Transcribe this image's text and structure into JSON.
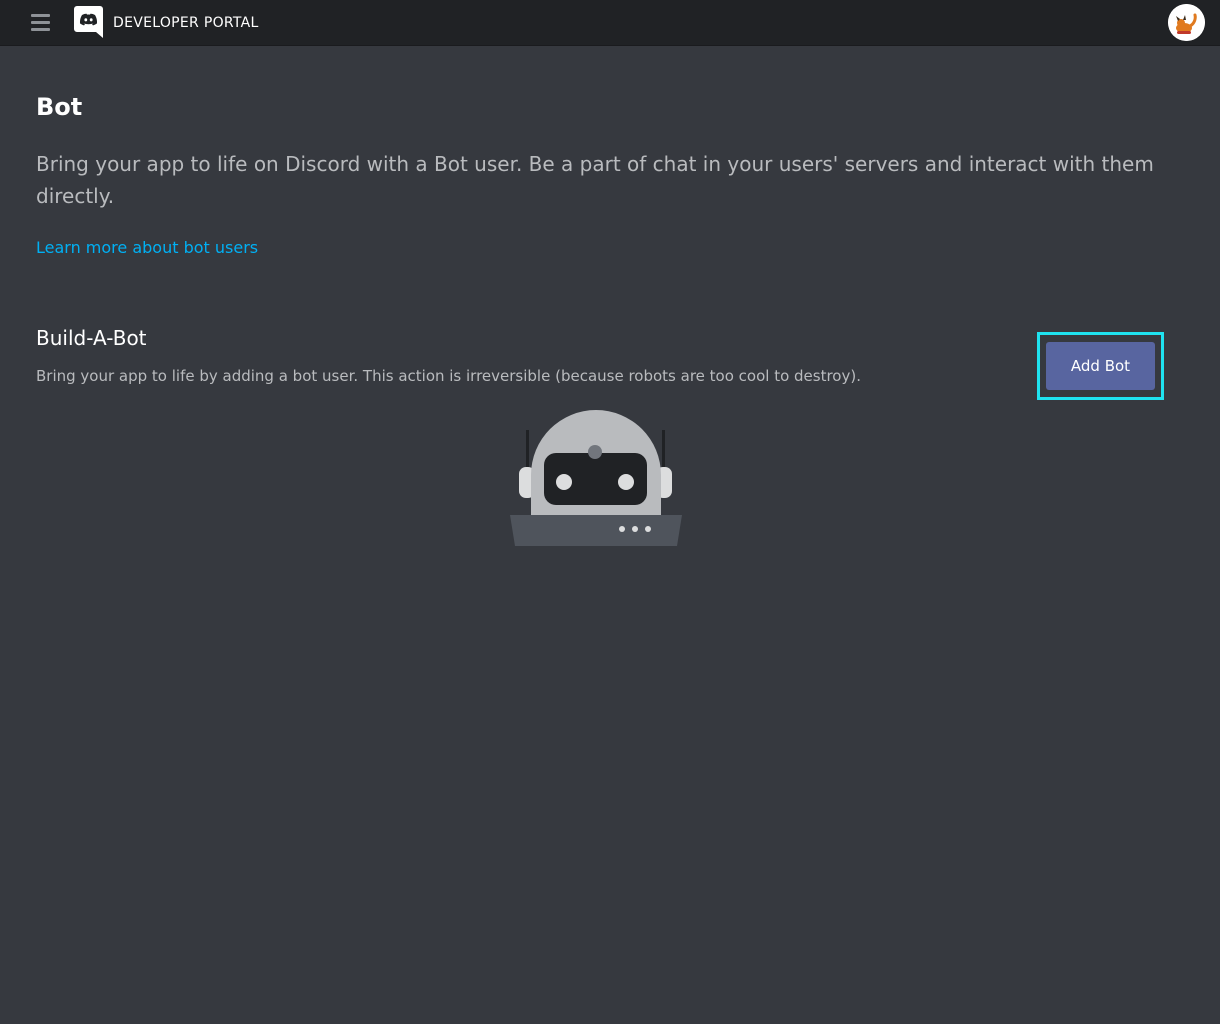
{
  "header": {
    "title": "DEVELOPER PORTAL",
    "menu_icon": "hamburger-menu-icon",
    "logo_icon": "discord-logo-icon",
    "avatar_icon": "user-avatar"
  },
  "page": {
    "title": "Bot",
    "description": "Bring your app to life on Discord with a Bot user. Be a part of chat in your users' servers and interact with them directly.",
    "learn_more_link": "Learn more about bot users"
  },
  "build_a_bot": {
    "title": "Build-A-Bot",
    "description": "Bring your app to life by adding a bot user. This action is irreversible (because robots are too cool to destroy).",
    "add_bot_label": "Add Bot",
    "illustration": "robot-illustration"
  },
  "colors": {
    "background": "#36393f",
    "topbar": "#202225",
    "link": "#00b0f4",
    "button": "#5865a0",
    "highlight": "#1fe3f0"
  }
}
